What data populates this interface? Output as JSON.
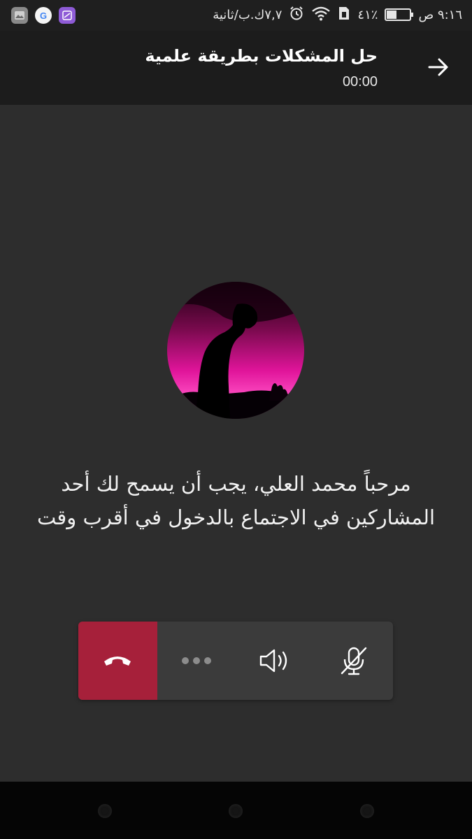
{
  "status_bar": {
    "time": "٩:١٦ ص",
    "battery_percent_text": "٤١٪",
    "battery_level": 0.41,
    "network_speed": "٧,٧ك.ب/ثانية",
    "icons": [
      "gallery-icon",
      "google-icon",
      "photo-editor-icon",
      "alarm-icon",
      "wifi-icon",
      "sim-icon",
      "battery-icon"
    ],
    "google_letter": "G"
  },
  "header": {
    "title": "حل المشكلات بطريقة علمية",
    "timer": "00:00",
    "back_icon": "arrow-right-icon"
  },
  "call": {
    "message": "مرحباً محمد العلي، يجب أن يسمح لك أحد المشاركين في الاجتماع بالدخول في أقرب وقت",
    "controls": [
      {
        "name": "hangup",
        "icon": "phone-hangup-icon",
        "color": "#a6203a"
      },
      {
        "name": "more",
        "icon": "more-dots-icon"
      },
      {
        "name": "speaker",
        "icon": "speaker-icon"
      },
      {
        "name": "mute",
        "icon": "mic-off-icon"
      }
    ]
  },
  "colors": {
    "background": "#2d2d2d",
    "header": "#1c1c1c",
    "hangup": "#a6203a",
    "controls_bg": "#3b3b3b"
  }
}
